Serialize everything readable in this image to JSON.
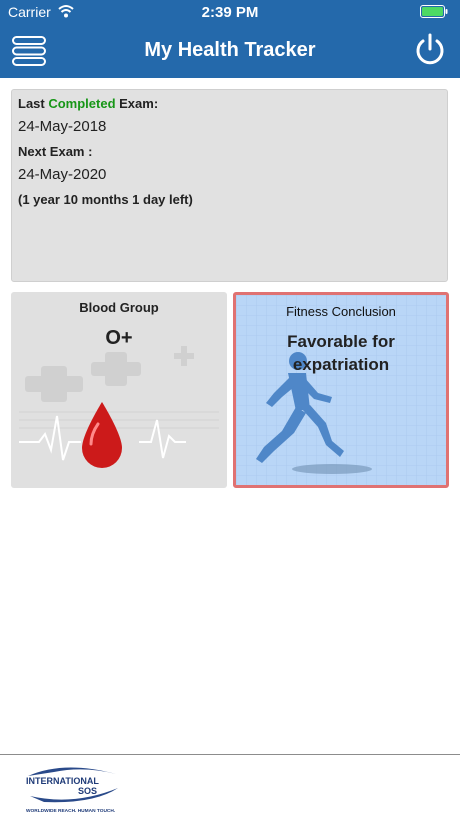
{
  "status_bar": {
    "carrier": "Carrier",
    "time": "2:39 PM"
  },
  "nav": {
    "title": "My Health Tracker"
  },
  "exam": {
    "last_prefix": "Last ",
    "last_highlight": "Completed",
    "last_suffix": " Exam:",
    "last_date": "24-May-2018",
    "next_label": "Next Exam :",
    "next_date": "24-May-2020",
    "time_left": "(1 year 10 months 1 day left)"
  },
  "blood": {
    "title": "Blood Group",
    "value": "O+"
  },
  "fitness": {
    "title": "Fitness Conclusion",
    "value": "Favorable for expatriation"
  },
  "colors": {
    "header": "#2469ab",
    "completed": "#179617",
    "fitness_bg": "#b9d6f7",
    "fitness_border": "#e07272",
    "blood": "#cc1a1a"
  },
  "logo": {
    "line1": "INTERNATIONAL",
    "line2": "SOS",
    "tagline": "WORLDWIDE REACH. HUMAN TOUCH."
  }
}
